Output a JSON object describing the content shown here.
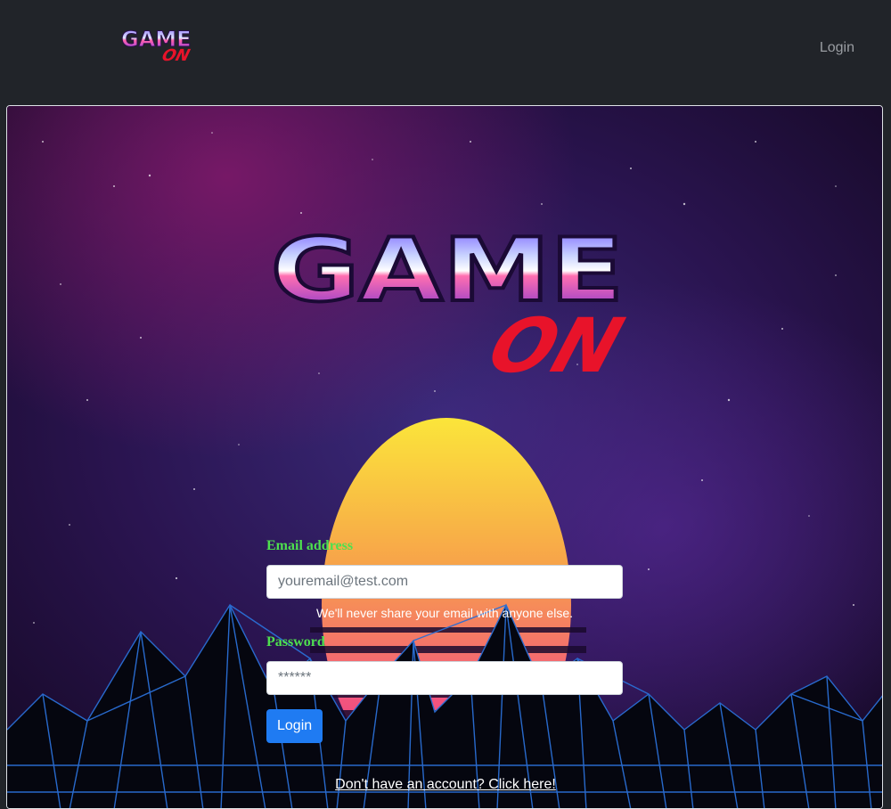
{
  "navbar": {
    "logo_alt": "GAME ON",
    "login_label": "Login"
  },
  "hero": {
    "logo_word_top": "GAME",
    "logo_word_bottom": "ON"
  },
  "form": {
    "email_label": "Email address",
    "email_placeholder": "youremail@test.com",
    "email_help": "We'll never share your email with anyone else.",
    "password_label": "Password",
    "password_placeholder": "******",
    "submit_label": "Login"
  },
  "signup_link": "Don't have an account? Click here!",
  "colors": {
    "navbar_bg": "#212429",
    "label_green": "#4ee04e",
    "button_blue": "#1f7bf2"
  }
}
